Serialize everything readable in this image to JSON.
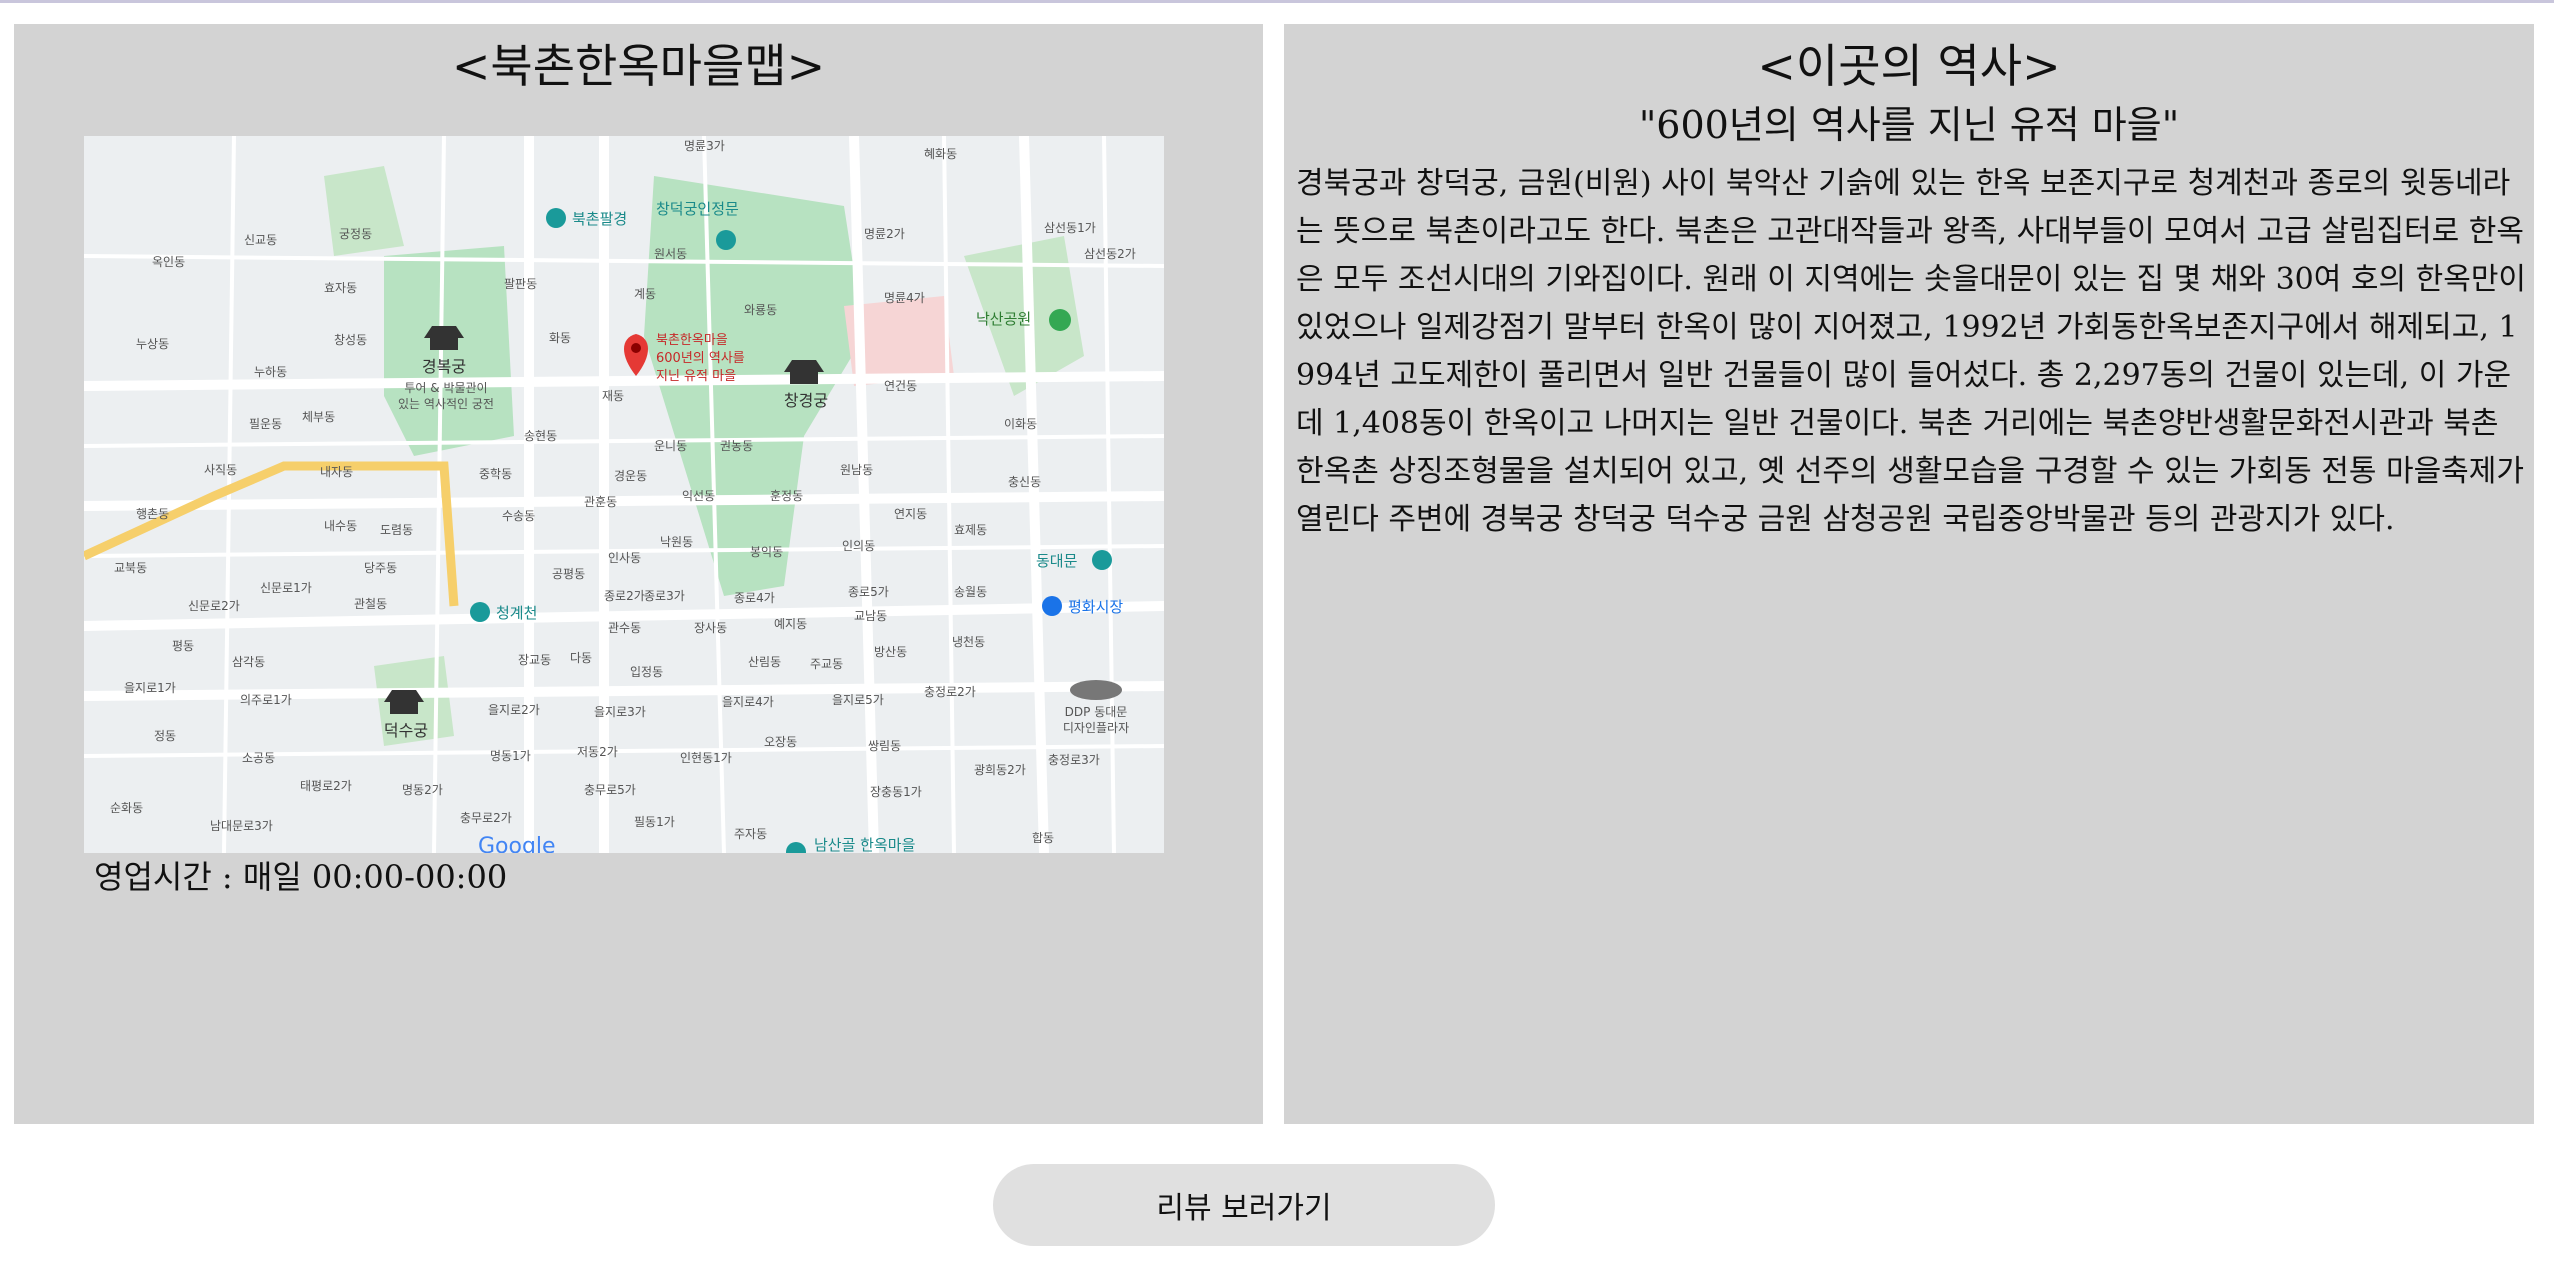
{
  "left_panel": {
    "title": "<북촌한옥마을맵>",
    "hours": "영업시간 : 매일 00:00-00:00",
    "map": {
      "brand": "Google",
      "pin": {
        "title": "북촌한옥마을",
        "line1": "600년의 역사를",
        "line2": "지닌 유적 마을"
      },
      "landmarks": {
        "gyeongbokgung": "경복궁",
        "gyeongbokgung_sub1": "투어 & 박물관이",
        "gyeongbokgung_sub2": "있는 역사적인 궁전",
        "changgyeonggung": "창경궁",
        "deoksugung": "덕수궁",
        "ddp": "DDP 동대문",
        "ddp_sub": "디자인플라자",
        "bukchon_palgyeong": "북촌팔경",
        "changdeokgung_gate": "창덕궁인정문",
        "naksan_park": "낙산공원",
        "cheonggyecheon": "청계천",
        "dongdaemun": "동대문",
        "pyeonghwa_market": "평화시장",
        "namsangol": "남산골 한옥마을"
      },
      "districts": [
        "명륜3가",
        "혜화동",
        "궁정동",
        "신교동",
        "옥인동",
        "효자동",
        "팔판동",
        "원서동",
        "계동",
        "명륜2가",
        "삼선동1가",
        "삼선동2가",
        "명륜4가",
        "와룡동",
        "누상동",
        "창성동",
        "화동",
        "재동",
        "연건동",
        "이화동",
        "누하동",
        "필운동",
        "체부동",
        "송현동",
        "운니동",
        "권농동",
        "원남동",
        "충신동",
        "사직동",
        "내자동",
        "중학동",
        "경운동",
        "익선동",
        "훈정동",
        "연지동",
        "효제동",
        "행촌동",
        "내수동",
        "도렴동",
        "수송동",
        "관훈동",
        "낙원동",
        "봉익동",
        "인의동",
        "교북동",
        "당주동",
        "인사동",
        "공평동",
        "종로2가",
        "종로3가",
        "종로4가",
        "종로5가",
        "송월동",
        "신문로2가",
        "신문로1가",
        "관철동",
        "관수동",
        "장사동",
        "예지동",
        "교남동",
        "평동",
        "삼각동",
        "다동",
        "장교동",
        "입정동",
        "산림동",
        "주교동",
        "방산동",
        "냉천동",
        "을지로1가",
        "을지로2가",
        "을지로3가",
        "을지로4가",
        "을지로5가",
        "충정로2가",
        "정동",
        "의주로1가",
        "소공동",
        "명동1가",
        "저동2가",
        "인현동1가",
        "오장동",
        "쌍림동",
        "광희동2가",
        "충정로3가",
        "순화동",
        "태평로2가",
        "명동2가",
        "충무로5가",
        "장충동1가",
        "합동",
        "남대문로3가",
        "충무로2가",
        "필동1가",
        "주자동"
      ]
    }
  },
  "right_panel": {
    "title": "<이곳의 역사>",
    "subtitle": "\"600년의 역사를 지닌 유적 마을\"",
    "body": "경북궁과 창덕궁, 금원(비원) 사이 북악산 기슭에 있는 한옥 보존지구로 청계천과 종로의 윗동네라는 뜻으로 북촌이라고도 한다. 북촌은 고관대작들과 왕족, 사대부들이 모여서 고급 살림집터로 한옥은 모두 조선시대의 기와집이다. 원래 이 지역에는 솟을대문이 있는 집 몇 채와 30여 호의 한옥만이 있었으나 일제강점기 말부터 한옥이 많이 지어졌고, 1992년 가회동한옥보존지구에서 해제되고, 1994년 고도제한이 풀리면서 일반 건물들이 많이 들어섰다. 총 2,297동의 건물이 있는데, 이 가운데 1,408동이 한옥이고 나머지는 일반 건물이다. 북촌 거리에는 북촌양반생활문화전시관과 북촌 한옥촌 상징조형물을 설치되어 있고, 옛 선주의 생활모습을 구경할 수 있는 가회동 전통 마을축제가 열린다 주변에 경북궁 창덕궁 덕수궁 금원 삼청공원 국립중앙박물관 등의 관광지가 있다."
  },
  "review_button": "리뷰 보러가기",
  "colors": {
    "panel_bg": "#d3d3d3",
    "button_bg": "#e0e0e0",
    "map_green": "#b7e2c1",
    "map_road": "#f6cf6b",
    "pin_red": "#e53935"
  }
}
